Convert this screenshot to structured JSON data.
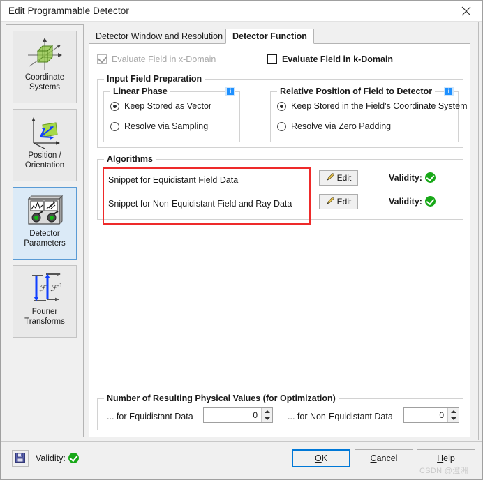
{
  "window": {
    "title": "Edit Programmable Detector",
    "close_icon": "close-icon"
  },
  "sidebar": {
    "items": [
      {
        "label": "Coordinate\nSystems",
        "icon": "coordinate-systems-icon",
        "selected": false
      },
      {
        "label": "Position /\nOrientation",
        "icon": "position-orientation-icon",
        "selected": false
      },
      {
        "label": "Detector\nParameters",
        "icon": "detector-parameters-icon",
        "selected": true
      },
      {
        "label": "Fourier\nTransforms",
        "icon": "fourier-transforms-icon",
        "selected": false
      }
    ]
  },
  "tabs": [
    {
      "label": "Detector Window and Resolution",
      "active": false
    },
    {
      "label": "Detector Function",
      "active": true
    }
  ],
  "domain_checks": {
    "x_domain": {
      "label": "Evaluate Field in x-Domain",
      "checked": true,
      "disabled": true
    },
    "k_domain": {
      "label": "Evaluate Field in k-Domain",
      "checked": false,
      "disabled": false
    }
  },
  "input_field_preparation": {
    "title": "Input Field Preparation",
    "linear_phase": {
      "title": "Linear Phase",
      "info_icon": "info-icon",
      "options": [
        {
          "label": "Keep Stored as Vector",
          "selected": true
        },
        {
          "label": "Resolve via Sampling",
          "selected": false
        }
      ]
    },
    "relative_position": {
      "title": "Relative Position of Field to Detector",
      "info_icon": "info-icon",
      "options": [
        {
          "label": "Keep Stored in the Field's Coordinate System",
          "selected": true
        },
        {
          "label": "Resolve via Zero Padding",
          "selected": false
        }
      ]
    }
  },
  "algorithms": {
    "title": "Algorithms",
    "highlight_color": "#ee2a2a",
    "rows": [
      {
        "label": "Snippet for Equidistant Field Data",
        "edit_label": "Edit",
        "edit_icon": "pencil-icon",
        "validity_label": "Validity:",
        "validity_icon": "check-circle-icon"
      },
      {
        "label": "Snippet for Non-Equidistant Field and Ray Data",
        "edit_label": "Edit",
        "edit_icon": "pencil-icon",
        "validity_label": "Validity:",
        "validity_icon": "check-circle-icon"
      }
    ]
  },
  "number_of_values": {
    "title": "Number of Resulting Physical Values (for Optimization)",
    "equidistant": {
      "label": "... for Equidistant Data",
      "value": "0"
    },
    "non_equidistant": {
      "label": "... for Non-Equidistant Data",
      "value": "0"
    }
  },
  "footer": {
    "save_icon": "save-floppy-icon",
    "validity_label": "Validity:",
    "validity_icon": "check-circle-icon",
    "buttons": {
      "ok": {
        "mnemonic": "O",
        "rest": "K"
      },
      "cancel": {
        "pre": "",
        "mnemonic": "C",
        "rest": "ancel"
      },
      "help": {
        "pre": "",
        "mnemonic": "H",
        "rest": "elp"
      }
    },
    "watermark": "CSDN @澄洲"
  },
  "colors": {
    "accent": "#0078d7",
    "selected_sidebar": "#dbeaf7",
    "info_blue": "#1e90ff",
    "valid_green": "#18a818",
    "highlight_red": "#ee2a2a"
  }
}
